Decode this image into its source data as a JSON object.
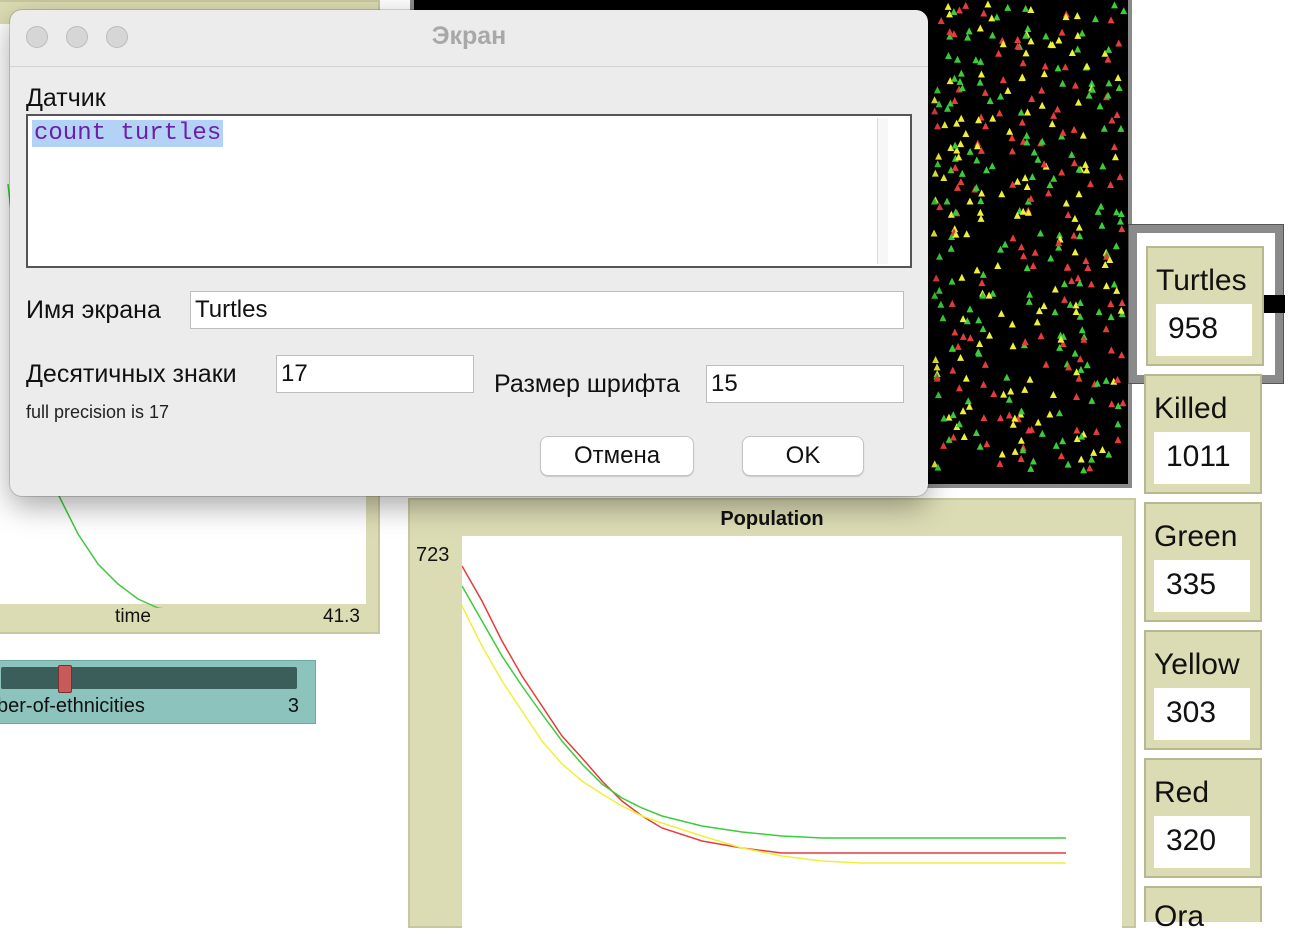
{
  "dialog": {
    "title": "Экран",
    "reporter_label": "Датчик",
    "reporter_code": "count turtles",
    "name_label": "Имя экрана",
    "name_value": "Turtles",
    "decimals_label": "Десятичных знаки",
    "decimals_value": "17",
    "precision_note": "full precision is 17",
    "font_size_label": "Размер шрифта",
    "font_size_value": "15",
    "cancel_label": "Отмена",
    "ok_label": "OK"
  },
  "left_plot": {
    "xlabel": "time",
    "xmax": "41.3"
  },
  "slider": {
    "label": "ber-of-ethnicities",
    "value": "3",
    "fraction": 0.2
  },
  "population_plot": {
    "title": "Population",
    "ymax": "723"
  },
  "monitors": [
    {
      "label": "Turtles",
      "value": "958"
    },
    {
      "label": "Killed",
      "value": "1011"
    },
    {
      "label": "Green",
      "value": "335"
    },
    {
      "label": "Yellow",
      "value": "303"
    },
    {
      "label": "Red",
      "value": "320"
    },
    {
      "label": "Ora",
      "value": ""
    }
  ],
  "colors": {
    "green": "#3ccc3c",
    "yellow": "#f0f03c",
    "red": "#e63c3c"
  }
}
